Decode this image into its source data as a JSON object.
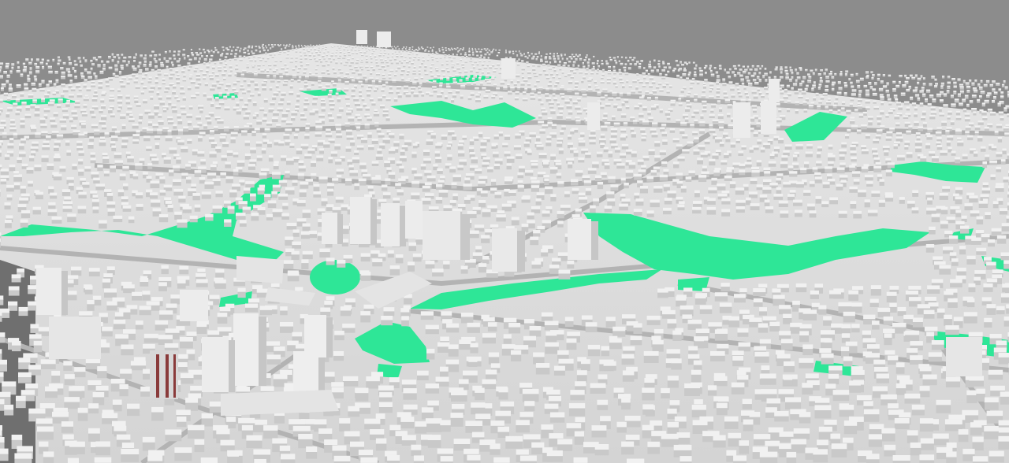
{
  "scene": {
    "description_visible_text": "",
    "palette": {
      "sky": "#8c8c8c",
      "ground": "#d6d6d6",
      "street": "#b7b7b7",
      "building_top": "#f2f2f2",
      "building_side": "#cfcfcf",
      "building_shadow": "#b9b9b9",
      "park": "#2ee697",
      "dark_area": "#6f6f6f",
      "accent_tower": "#8a3b3b"
    }
  }
}
